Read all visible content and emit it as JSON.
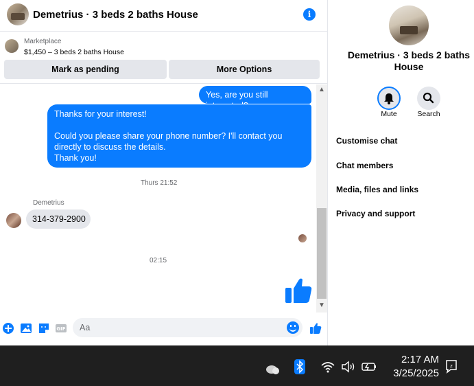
{
  "header": {
    "title": "Demetrius · 3 beds 2 baths House",
    "info_icon": "info-icon"
  },
  "marketplace": {
    "label": "Marketplace",
    "listing": "$1,450 – 3 beds 2 baths House",
    "btn_pending": "Mark as pending",
    "btn_more": "More Options"
  },
  "messages": {
    "out1": "Yes, are you still interested?",
    "out2": "Thanks for your interest!\n\nCould you please share your phone number? I'll contact you directly to discuss the details.\nThank you!",
    "ts1": "Thurs 21:52",
    "sender": "Demetrius",
    "in1": "314-379-2900",
    "ts2": "02:15"
  },
  "composer": {
    "placeholder": "Aa"
  },
  "right": {
    "title": "Demetrius · 3 beds 2 baths House",
    "mute": "Mute",
    "search": "Search",
    "items": [
      "Customise chat",
      "Chat members",
      "Media, files and links",
      "Privacy and support"
    ]
  },
  "taskbar": {
    "time": "2:17 AM",
    "date": "3/25/2025"
  },
  "colors": {
    "accent": "#0a7cff",
    "bubble_in": "#e4e6eb",
    "taskbar": "#1f1f1f"
  }
}
